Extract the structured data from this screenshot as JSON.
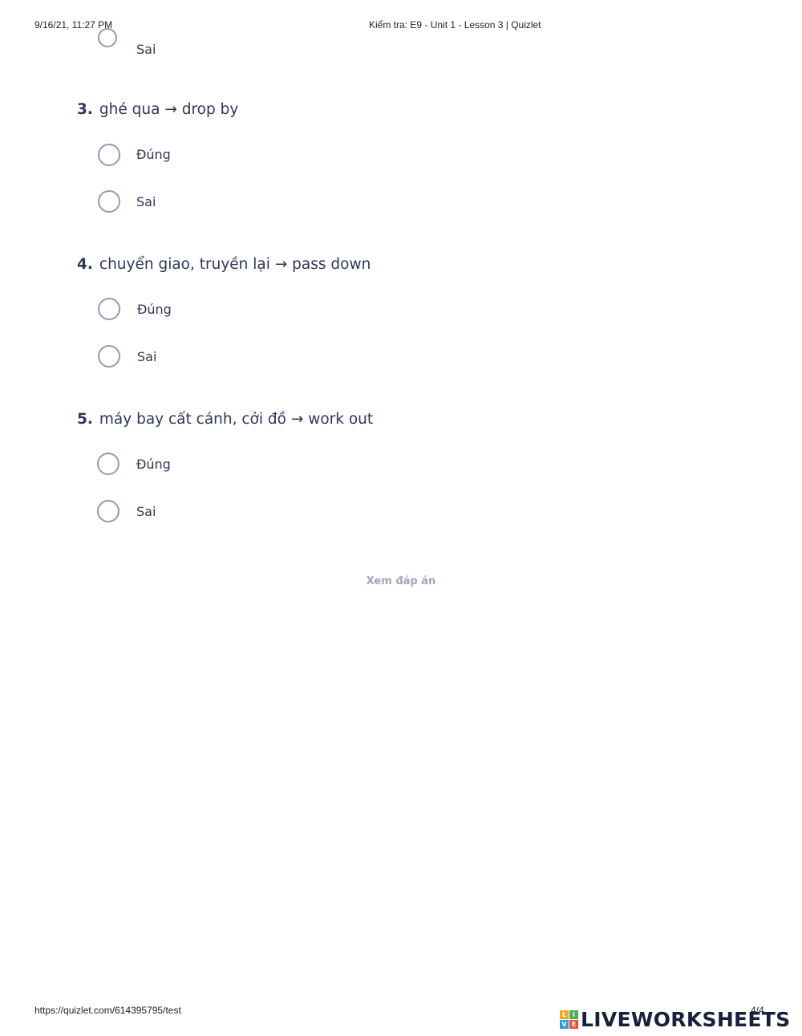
{
  "header": {
    "datetime": "9/16/21, 11:27 PM",
    "title": "Kiểm tra: E9 - Unit 1 - Lesson 3 | Quizlet"
  },
  "partial_top": {
    "option_label": "Sai"
  },
  "questions": [
    {
      "number": "3.",
      "text": "ghé qua → drop by",
      "options": [
        "Đúng",
        "Sai"
      ]
    },
    {
      "number": "4.",
      "text": "chuyển giao, truyền lại → pass down",
      "options": [
        "Đúng",
        "Sai"
      ]
    },
    {
      "number": "5.",
      "text": "máy bay cất cánh, cởi đồ → work out",
      "options": [
        "Đúng",
        "Sai"
      ]
    }
  ],
  "see_answers_label": "Xem đáp án",
  "footer": {
    "url": "https://quizlet.com/614395795/test",
    "page": "4/4"
  },
  "watermark": {
    "text": "LIVEWORKSHEETS",
    "blocks": [
      "L",
      "I",
      "V",
      "E"
    ],
    "block_colors": [
      "#f5a623",
      "#4cae4f",
      "#2d9cdb",
      "#e74c3c"
    ]
  },
  "colors": {
    "text": "#2e3856",
    "radio_border": "#939bb4",
    "muted": "#a0a6b8"
  }
}
